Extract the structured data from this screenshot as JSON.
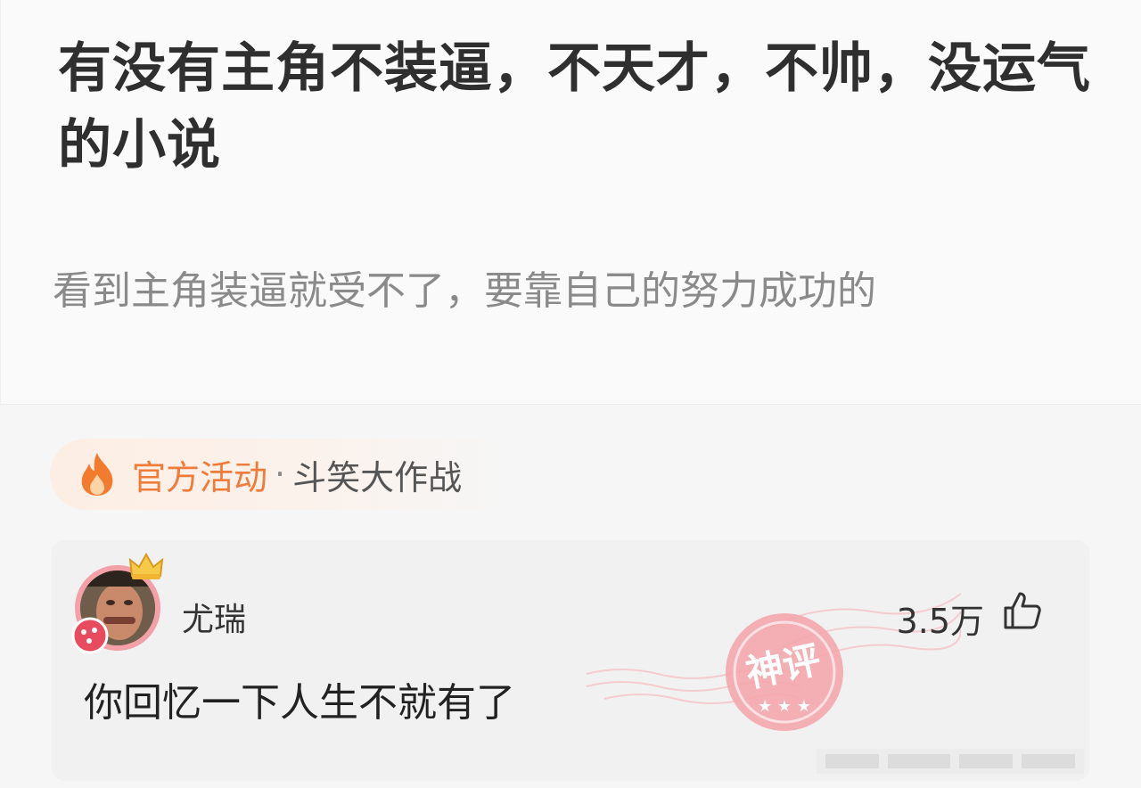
{
  "question": {
    "title": "有没有主角不装逼，不天才，不帅，没运气的小说",
    "description": "看到主角装逼就受不了，要靠自己的努力成功的"
  },
  "activity": {
    "icon": "fire-icon",
    "label": "官方活动",
    "separator": "·",
    "name": "斗笑大作战",
    "accent_color": "#f07c3a"
  },
  "answer": {
    "username": "尤瑞",
    "likes": "3.5万",
    "text": "你回忆一下人生不就有了",
    "stamp_text": "神评",
    "stamp_color": "#f2a3a8"
  }
}
